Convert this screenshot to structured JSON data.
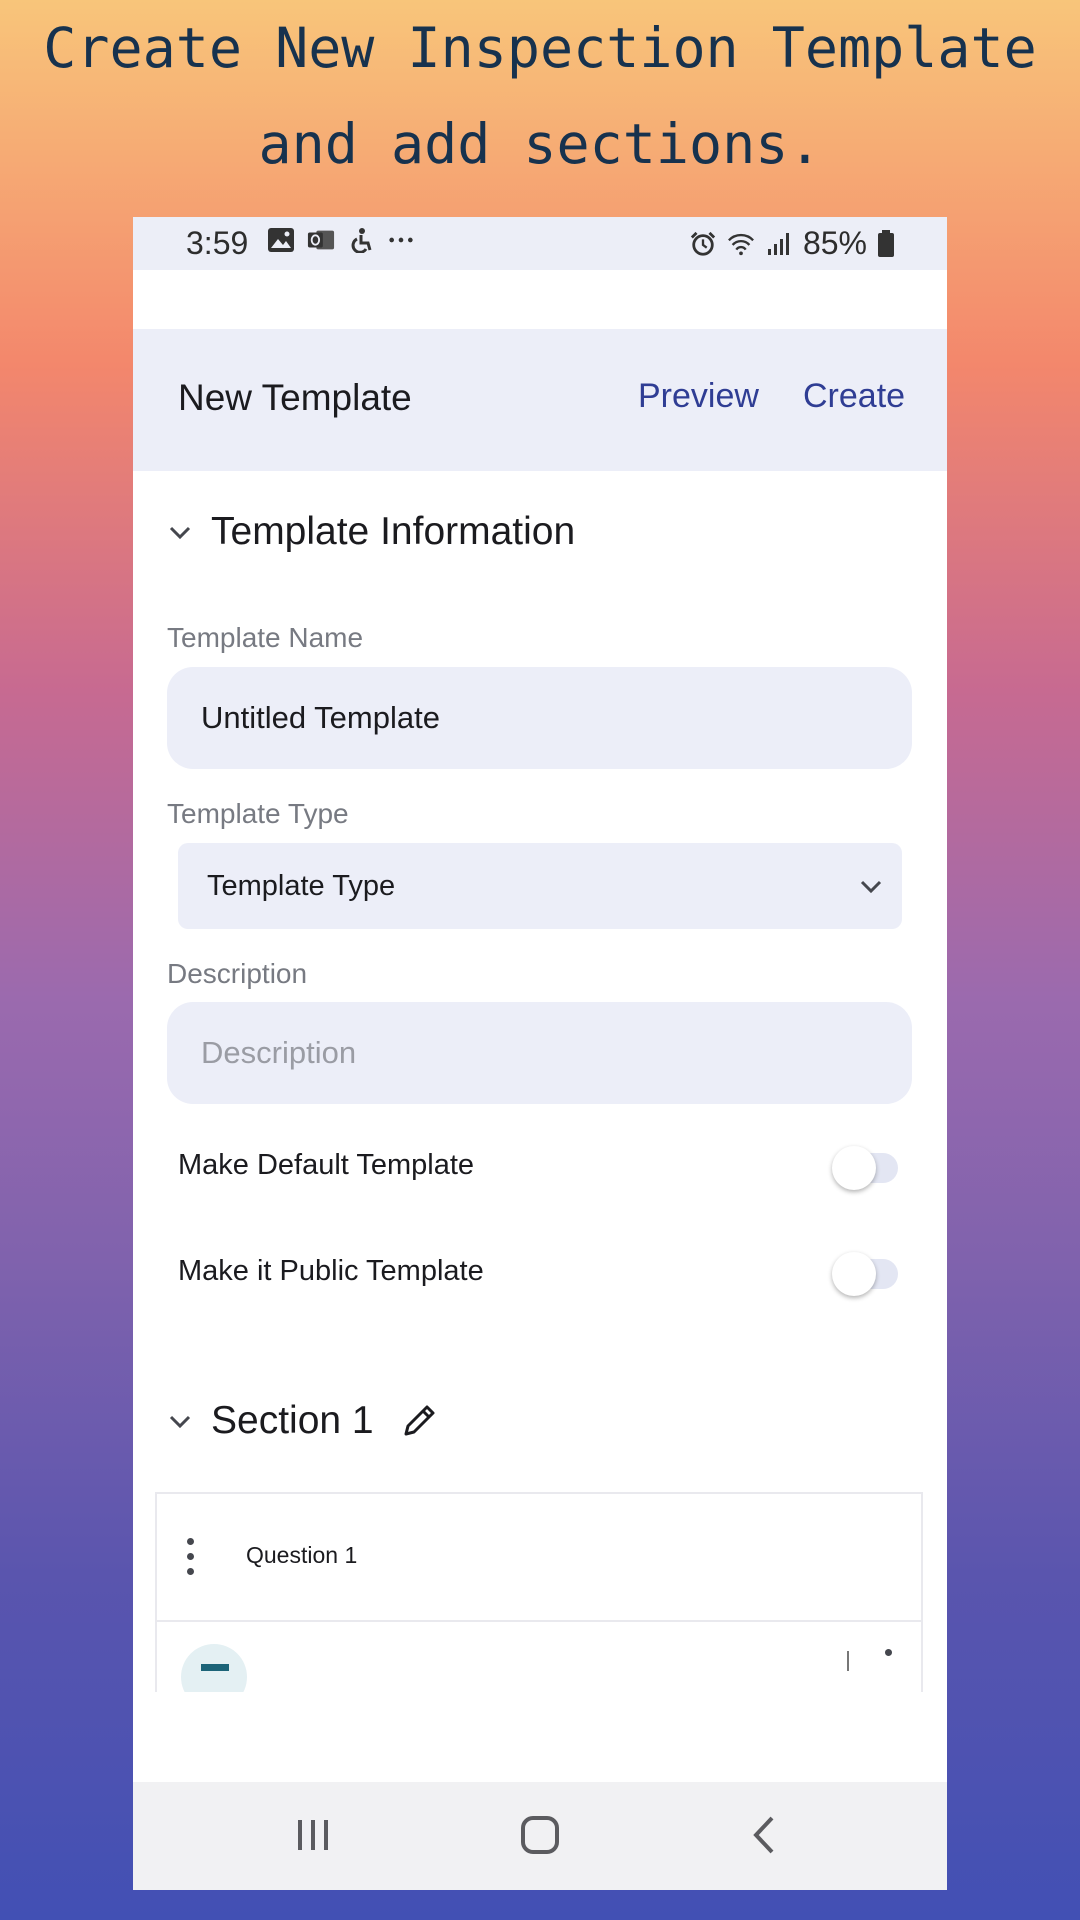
{
  "headline": {
    "line1": "Create New Inspection Template",
    "line2": "and add sections."
  },
  "status_bar": {
    "time": "3:59",
    "battery": "85%",
    "left_icons": [
      "image-icon",
      "outlook-icon",
      "accessibility-icon",
      "more-dots-icon"
    ],
    "right_icons": [
      "alarm-icon",
      "wifi-icon",
      "signal-icon",
      "battery-icon"
    ]
  },
  "app_bar": {
    "title": "New Template",
    "preview": "Preview",
    "create": "Create"
  },
  "template_info": {
    "title": "Template Information",
    "name_label": "Template Name",
    "name_value": "Untitled Template",
    "type_label": "Template Type",
    "type_value": "Template Type",
    "description_label": "Description",
    "description_placeholder": "Description",
    "default_label": "Make Default Template",
    "default_on": false,
    "public_label": "Make it Public Template",
    "public_on": false
  },
  "section": {
    "title": "Section 1",
    "questions": [
      {
        "label": "Question 1"
      }
    ]
  },
  "colors": {
    "accent": "#2f3d94",
    "field_bg": "#eceef8",
    "headline": "#17324e"
  }
}
